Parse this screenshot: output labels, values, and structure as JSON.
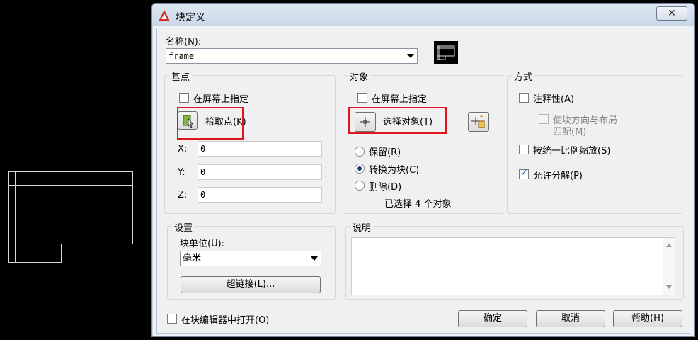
{
  "dialog": {
    "title": "块定义",
    "close_label": "✕"
  },
  "name": {
    "label": "名称(N):",
    "value": "frame"
  },
  "base_point": {
    "title": "基点",
    "specify_on_screen": "在屏幕上指定",
    "pick_point": "拾取点(K)",
    "x_label": "X:",
    "x_value": "0",
    "y_label": "Y:",
    "y_value": "0",
    "z_label": "Z:",
    "z_value": "0"
  },
  "objects": {
    "title": "对象",
    "specify_on_screen": "在屏幕上指定",
    "select_objects": "选择对象(T)",
    "retain": "保留(R)",
    "convert_to_block": "转换为块(C)",
    "delete": "删除(D)",
    "selected_count": "已选择 4 个对象"
  },
  "behavior": {
    "title": "方式",
    "annotative": "注释性(A)",
    "match_orientation_line1": "使块方向与布局",
    "match_orientation_line2": "匹配(M)",
    "scale_uniformly": "按统一比例缩放(S)",
    "allow_exploding": "允许分解(P)"
  },
  "settings": {
    "title": "设置",
    "block_unit_label": "块单位(U):",
    "block_unit_value": "毫米",
    "hyperlink_button": "超链接(L)..."
  },
  "description": {
    "title": "说明"
  },
  "footer": {
    "open_in_editor": "在块编辑器中打开(O)",
    "ok": "确定",
    "cancel": "取消",
    "help": "帮助(H)"
  },
  "colors": {
    "highlight_box": "#e0141e",
    "canvas_bg": "#000000"
  }
}
